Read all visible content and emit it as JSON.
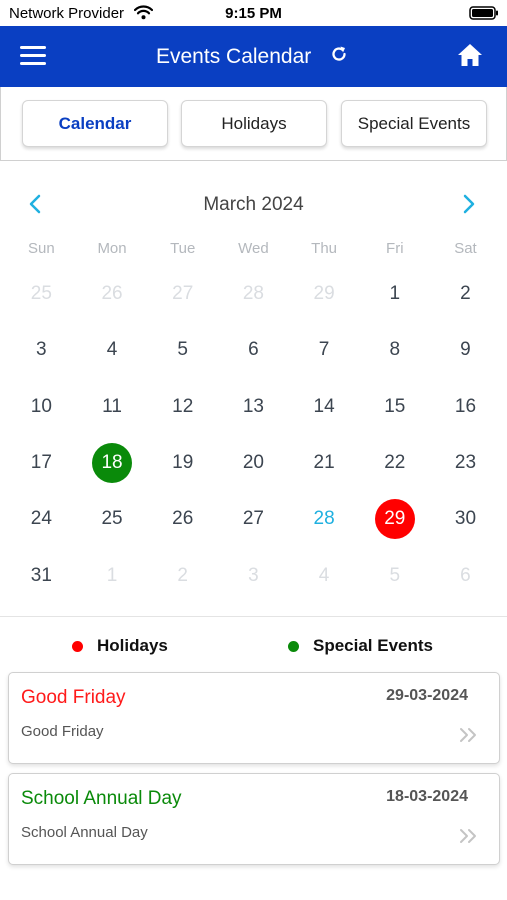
{
  "status_bar": {
    "carrier": "Network Provider",
    "time": "9:15 PM"
  },
  "header": {
    "title": "Events Calendar",
    "color": "#0a3fc2"
  },
  "tabs": [
    {
      "label": "Calendar",
      "active": true
    },
    {
      "label": "Holidays",
      "active": false
    },
    {
      "label": "Special Events",
      "active": false
    }
  ],
  "calendar": {
    "month_label": "March 2024",
    "weekdays": [
      "Sun",
      "Mon",
      "Tue",
      "Wed",
      "Thu",
      "Fri",
      "Sat"
    ],
    "days": [
      {
        "label": "25",
        "other_month": true
      },
      {
        "label": "26",
        "other_month": true
      },
      {
        "label": "27",
        "other_month": true
      },
      {
        "label": "28",
        "other_month": true
      },
      {
        "label": "29",
        "other_month": true
      },
      {
        "label": "1"
      },
      {
        "label": "2"
      },
      {
        "label": "3"
      },
      {
        "label": "4"
      },
      {
        "label": "5"
      },
      {
        "label": "6"
      },
      {
        "label": "7"
      },
      {
        "label": "8"
      },
      {
        "label": "9"
      },
      {
        "label": "10"
      },
      {
        "label": "11"
      },
      {
        "label": "12"
      },
      {
        "label": "13"
      },
      {
        "label": "14"
      },
      {
        "label": "15"
      },
      {
        "label": "16"
      },
      {
        "label": "17"
      },
      {
        "label": "18",
        "marker": "special"
      },
      {
        "label": "19"
      },
      {
        "label": "20"
      },
      {
        "label": "21"
      },
      {
        "label": "22"
      },
      {
        "label": "23"
      },
      {
        "label": "24"
      },
      {
        "label": "25"
      },
      {
        "label": "26"
      },
      {
        "label": "27"
      },
      {
        "label": "28",
        "today": true
      },
      {
        "label": "29",
        "marker": "holiday"
      },
      {
        "label": "30"
      },
      {
        "label": "31"
      },
      {
        "label": "1",
        "other_month": true
      },
      {
        "label": "2",
        "other_month": true
      },
      {
        "label": "3",
        "other_month": true
      },
      {
        "label": "4",
        "other_month": true
      },
      {
        "label": "5",
        "other_month": true
      },
      {
        "label": "6",
        "other_month": true
      }
    ]
  },
  "legend": [
    {
      "label": "Holidays",
      "color": "#ff0000"
    },
    {
      "label": "Special Events",
      "color": "#0a8a0a"
    }
  ],
  "events": [
    {
      "title": "Good Friday",
      "date": "29-03-2024",
      "description": "Good Friday",
      "color": "#ff1a1a"
    },
    {
      "title": "School Annual Day",
      "date": "18-03-2024",
      "description": "School Annual Day",
      "color": "#0a8a0a"
    }
  ],
  "colors": {
    "holiday": "#ff0000",
    "special": "#0a8a0a",
    "today": "#1fb0e0",
    "nav_arrow": "#1fb0e0"
  },
  "icons": [
    "wifi-icon",
    "battery-icon",
    "menu-icon",
    "refresh-icon",
    "home-icon",
    "chevron-left-icon",
    "chevron-right-icon",
    "double-chevron-right-icon"
  ]
}
